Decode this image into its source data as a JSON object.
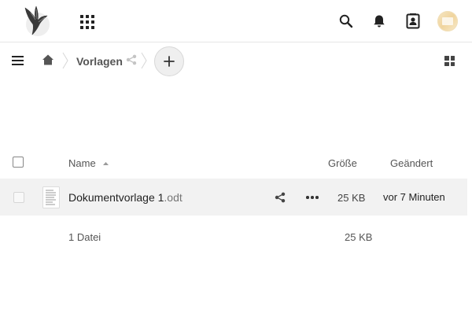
{
  "header": {
    "logo_icon": "nextcloud-bird-logo",
    "apps_icon": "apps-grid-icon",
    "search_icon": "search-icon",
    "notifications_icon": "bell-icon",
    "contacts_icon": "contacts-icon",
    "avatar_icon": "user-avatar"
  },
  "breadcrumb": {
    "menu_icon": "hamburger-menu-icon",
    "home_icon": "home-icon",
    "folder": "Vorlagen",
    "share_icon": "share-icon",
    "new_icon": "plus-icon",
    "view_toggle_icon": "grid-view-icon"
  },
  "table": {
    "columns": {
      "name": "Name",
      "size": "Größe",
      "modified": "Geändert"
    },
    "sort": {
      "column": "name",
      "direction": "ascending"
    },
    "rows": [
      {
        "basename": "Dokumentvorlage 1",
        "extension": ".odt",
        "size": "25 KB",
        "modified": "vor 7 Minuten",
        "type_icon": "document-file-icon"
      }
    ],
    "summary": {
      "count": "1 Datei",
      "total_size": "25 KB"
    }
  },
  "colors": {
    "row_hover": "#f2f2f2",
    "text": "#222222",
    "muted_text": "#555555"
  }
}
